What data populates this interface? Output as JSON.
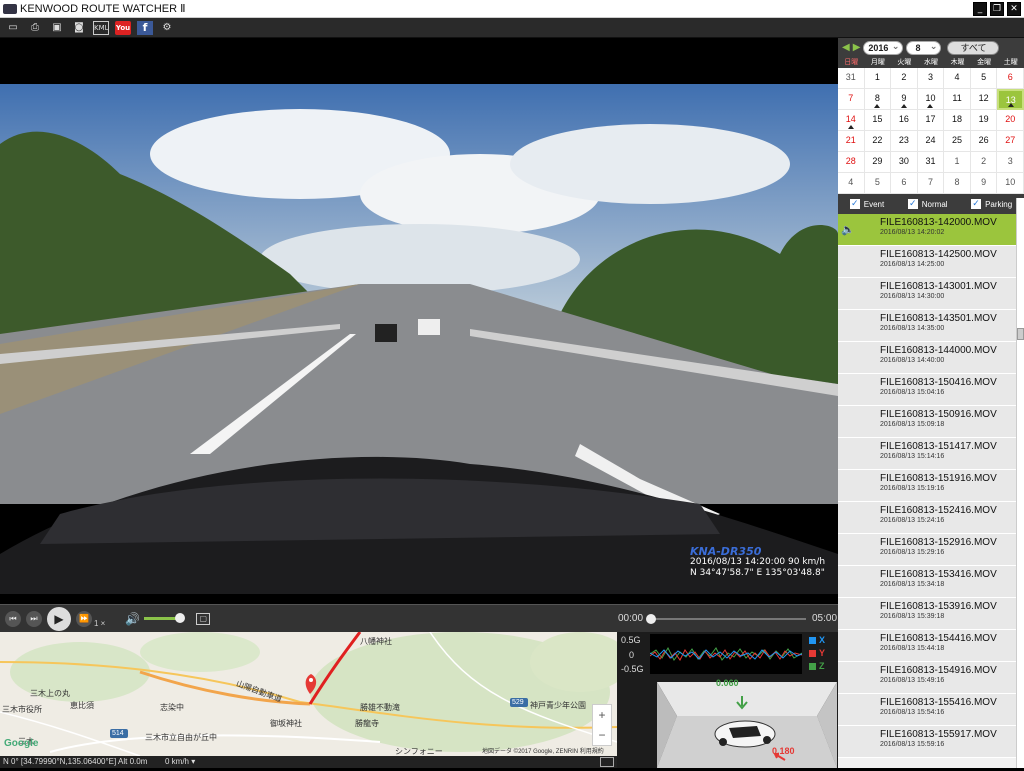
{
  "app": {
    "title": "KENWOOD ROUTE WATCHER Ⅱ"
  },
  "window_buttons": {
    "minimize": "_",
    "restore": "❐",
    "close": "✕"
  },
  "toolbar": {
    "icons": [
      "open-folder-icon",
      "print-icon",
      "save-icon",
      "snapshot-icon",
      "kml-icon",
      "youtube-icon",
      "facebook-icon",
      "settings-icon"
    ],
    "kml_label": "KML",
    "youtube_label": "You Tube",
    "facebook_label": "f"
  },
  "video": {
    "osd_brand": "KNA-DR350",
    "osd_line1": "2016/08/13 14:20:00  90 km/h",
    "osd_line2": "N 34°47'58.7\"   E  135°03'48.8\""
  },
  "playback": {
    "rate": "1 ×",
    "volume_level": 0.9,
    "time_current": "00:00",
    "time_total": "05:00",
    "progress": 0.0
  },
  "map": {
    "labels": [
      "八幡神社",
      "勝雄不動滝",
      "勝龍寺",
      "御坂神社",
      "志染中",
      "三木上の丸",
      "三木市役所",
      "恵比須",
      "三木市立自由が丘中",
      "三木",
      "山陽自動車道",
      "神戸青少年公園",
      "シンフォニー"
    ],
    "attribution": "地図データ ©2017 Google, ZENRIN   利用規約",
    "logo": "Google",
    "road_numbers": [
      "529",
      "514"
    ]
  },
  "status": {
    "coords": "N 0° [34.79990°N,135.06400°E] Alt 0.0m",
    "speed": "0    km/h ▾"
  },
  "gsensor": {
    "labels": [
      "0.5G",
      "0",
      "-0.5G"
    ],
    "legend": [
      {
        "axis": "X",
        "color": "#2196f3"
      },
      {
        "axis": "Y",
        "color": "#e53935"
      },
      {
        "axis": "Z",
        "color": "#43a047"
      }
    ],
    "value_top": "0.060",
    "value_side": "0.180"
  },
  "calendar": {
    "year": "2016",
    "month": "8",
    "all_label": "すべて",
    "weekdays": [
      "日曜",
      "月曜",
      "火曜",
      "水曜",
      "木曜",
      "金曜",
      "土曜"
    ],
    "days": [
      {
        "d": "31",
        "other": true
      },
      {
        "d": "1"
      },
      {
        "d": "2"
      },
      {
        "d": "3"
      },
      {
        "d": "4"
      },
      {
        "d": "5"
      },
      {
        "d": "6",
        "sat": true
      },
      {
        "d": "7",
        "sun": true
      },
      {
        "d": "8",
        "dot": true
      },
      {
        "d": "9",
        "dot": true
      },
      {
        "d": "10",
        "dot": true
      },
      {
        "d": "11"
      },
      {
        "d": "12"
      },
      {
        "d": "13",
        "sat": true,
        "sel": true,
        "dot": true
      },
      {
        "d": "14",
        "sun": true,
        "dot": true
      },
      {
        "d": "15"
      },
      {
        "d": "16"
      },
      {
        "d": "17"
      },
      {
        "d": "18"
      },
      {
        "d": "19"
      },
      {
        "d": "20",
        "sat": true
      },
      {
        "d": "21",
        "sun": true
      },
      {
        "d": "22"
      },
      {
        "d": "23"
      },
      {
        "d": "24"
      },
      {
        "d": "25"
      },
      {
        "d": "26"
      },
      {
        "d": "27",
        "sat": true
      },
      {
        "d": "28",
        "sun": true
      },
      {
        "d": "29"
      },
      {
        "d": "30"
      },
      {
        "d": "31"
      },
      {
        "d": "1",
        "other": true
      },
      {
        "d": "2",
        "other": true
      },
      {
        "d": "3",
        "other": true
      },
      {
        "d": "4",
        "other": true
      },
      {
        "d": "5",
        "other": true
      },
      {
        "d": "6",
        "other": true
      },
      {
        "d": "7",
        "other": true
      },
      {
        "d": "8",
        "other": true
      },
      {
        "d": "9",
        "other": true
      },
      {
        "d": "10",
        "other": true
      }
    ]
  },
  "filters": [
    {
      "label": "Event",
      "checked": true
    },
    {
      "label": "Normal",
      "checked": true
    },
    {
      "label": "Parking",
      "checked": true
    }
  ],
  "files": [
    {
      "name": "FILE160813-142000.MOV",
      "time": "2016/08/13   14:20:02",
      "active": true
    },
    {
      "name": "FILE160813-142500.MOV",
      "time": "2016/08/13   14:25:00"
    },
    {
      "name": "FILE160813-143001.MOV",
      "time": "2016/08/13   14:30:00"
    },
    {
      "name": "FILE160813-143501.MOV",
      "time": "2016/08/13   14:35:00"
    },
    {
      "name": "FILE160813-144000.MOV",
      "time": "2016/08/13   14:40:00"
    },
    {
      "name": "FILE160813-150416.MOV",
      "time": "2016/08/13   15:04:16"
    },
    {
      "name": "FILE160813-150916.MOV",
      "time": "2016/08/13   15:09:18"
    },
    {
      "name": "FILE160813-151417.MOV",
      "time": "2016/08/13   15:14:16"
    },
    {
      "name": "FILE160813-151916.MOV",
      "time": "2016/08/13   15:19:16"
    },
    {
      "name": "FILE160813-152416.MOV",
      "time": "2016/08/13   15:24:16"
    },
    {
      "name": "FILE160813-152916.MOV",
      "time": "2016/08/13   15:29:16"
    },
    {
      "name": "FILE160813-153416.MOV",
      "time": "2016/08/13   15:34:18"
    },
    {
      "name": "FILE160813-153916.MOV",
      "time": "2016/08/13   15:39:18"
    },
    {
      "name": "FILE160813-154416.MOV",
      "time": "2016/08/13   15:44:18"
    },
    {
      "name": "FILE160813-154916.MOV",
      "time": "2016/08/13   15:49:16"
    },
    {
      "name": "FILE160813-155416.MOV",
      "time": "2016/08/13   15:54:16"
    },
    {
      "name": "FILE160813-155917.MOV",
      "time": "2016/08/13   15:59:16"
    }
  ]
}
